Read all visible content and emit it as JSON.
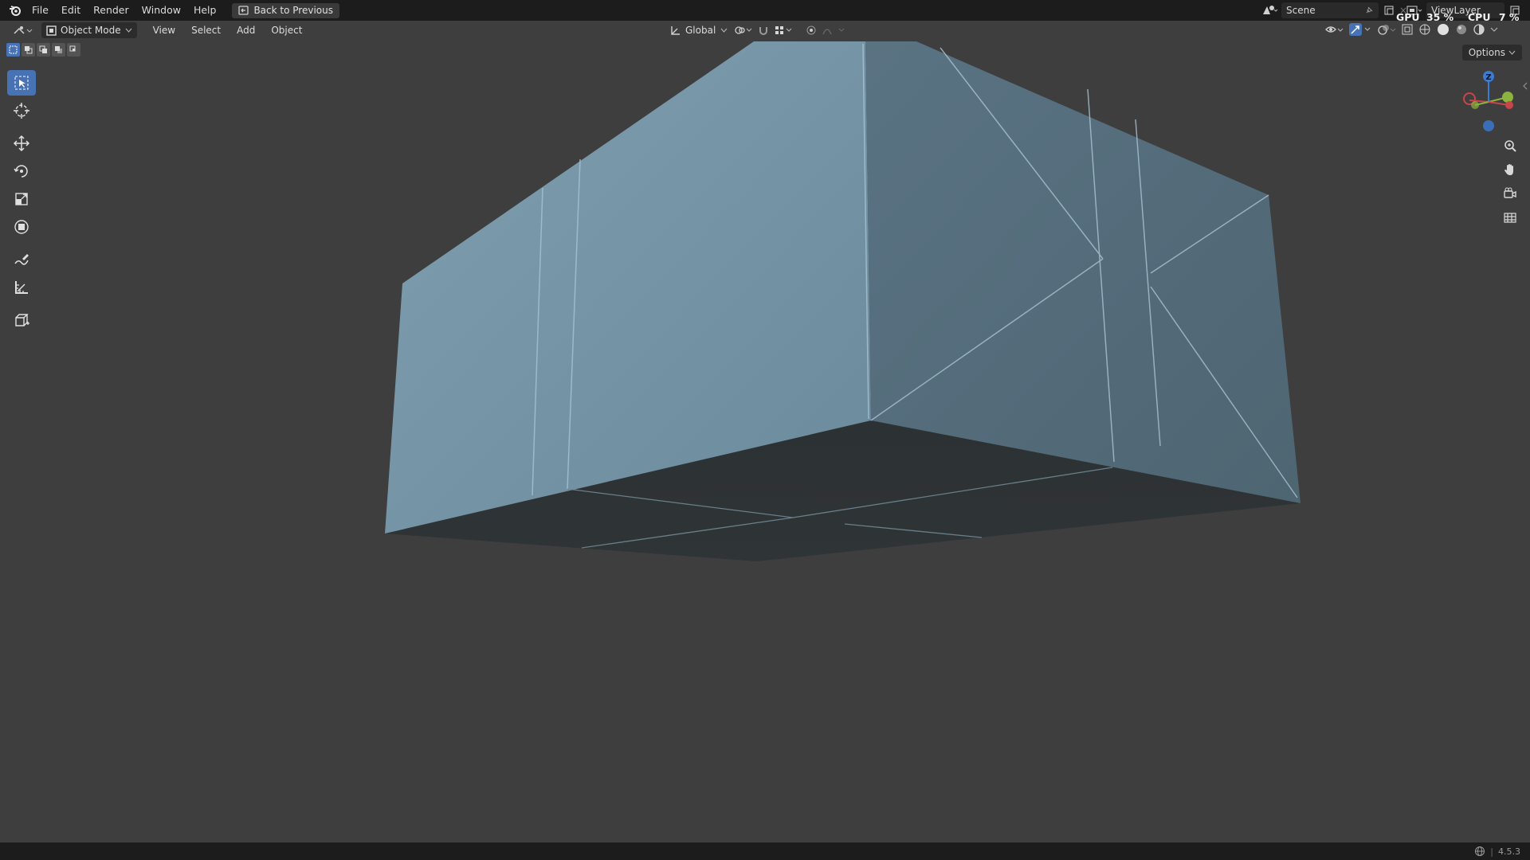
{
  "topbar": {
    "menus": [
      "File",
      "Edit",
      "Render",
      "Window",
      "Help"
    ],
    "back_button": "Back to Previous",
    "scene_label": "Scene",
    "viewlayer_label": "ViewLayer",
    "gpu_label": "GPU",
    "gpu_value": "35 %",
    "cpu_label": "CPU",
    "cpu_value": "7 %"
  },
  "header": {
    "mode": "Object Mode",
    "menus": [
      "View",
      "Select",
      "Add",
      "Object"
    ],
    "orientation": "Global",
    "options_label": "Options"
  },
  "gizmo": {
    "z_label": "Z"
  },
  "status": {
    "version": "4.5.3"
  },
  "colors": {
    "accent": "#4772b3",
    "background": "#3e3e3e",
    "mesh": "#6d8fa2"
  },
  "toolbar": {
    "tools": [
      "select-box-icon",
      "cursor-icon",
      "move-icon",
      "rotate-icon",
      "scale-icon",
      "transform-icon",
      "annotate-icon",
      "measure-icon",
      "add-cube-icon"
    ]
  }
}
